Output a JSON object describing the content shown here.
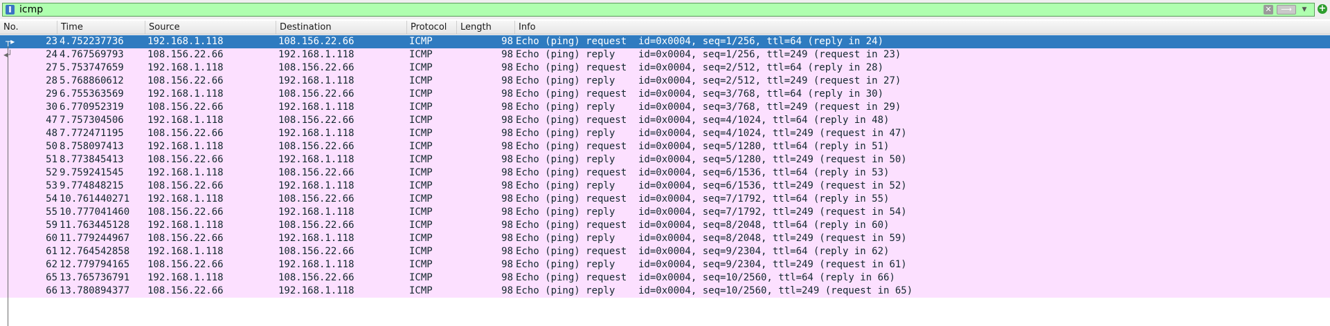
{
  "filter": {
    "value": "icmp",
    "clear_glyph": "✕",
    "apply_glyph": "⟶",
    "dropdown_glyph": "▼",
    "add_glyph": "+"
  },
  "columns": {
    "no": "No.",
    "time": "Time",
    "source": "Source",
    "destination": "Destination",
    "protocol": "Protocol",
    "length": "Length",
    "info": "Info"
  },
  "packets": [
    {
      "no": "23",
      "time": "4.752237736",
      "src": "192.168.1.118",
      "dst": "108.156.22.66",
      "proto": "ICMP",
      "len": "98",
      "info": "Echo (ping) request  id=0x0004, seq=1/256, ttl=64 (reply in 24)"
    },
    {
      "no": "24",
      "time": "4.767569793",
      "src": "108.156.22.66",
      "dst": "192.168.1.118",
      "proto": "ICMP",
      "len": "98",
      "info": "Echo (ping) reply    id=0x0004, seq=1/256, ttl=249 (request in 23)"
    },
    {
      "no": "27",
      "time": "5.753747659",
      "src": "192.168.1.118",
      "dst": "108.156.22.66",
      "proto": "ICMP",
      "len": "98",
      "info": "Echo (ping) request  id=0x0004, seq=2/512, ttl=64 (reply in 28)"
    },
    {
      "no": "28",
      "time": "5.768860612",
      "src": "108.156.22.66",
      "dst": "192.168.1.118",
      "proto": "ICMP",
      "len": "98",
      "info": "Echo (ping) reply    id=0x0004, seq=2/512, ttl=249 (request in 27)"
    },
    {
      "no": "29",
      "time": "6.755363569",
      "src": "192.168.1.118",
      "dst": "108.156.22.66",
      "proto": "ICMP",
      "len": "98",
      "info": "Echo (ping) request  id=0x0004, seq=3/768, ttl=64 (reply in 30)"
    },
    {
      "no": "30",
      "time": "6.770952319",
      "src": "108.156.22.66",
      "dst": "192.168.1.118",
      "proto": "ICMP",
      "len": "98",
      "info": "Echo (ping) reply    id=0x0004, seq=3/768, ttl=249 (request in 29)"
    },
    {
      "no": "47",
      "time": "7.757304506",
      "src": "192.168.1.118",
      "dst": "108.156.22.66",
      "proto": "ICMP",
      "len": "98",
      "info": "Echo (ping) request  id=0x0004, seq=4/1024, ttl=64 (reply in 48)"
    },
    {
      "no": "48",
      "time": "7.772471195",
      "src": "108.156.22.66",
      "dst": "192.168.1.118",
      "proto": "ICMP",
      "len": "98",
      "info": "Echo (ping) reply    id=0x0004, seq=4/1024, ttl=249 (request in 47)"
    },
    {
      "no": "50",
      "time": "8.758097413",
      "src": "192.168.1.118",
      "dst": "108.156.22.66",
      "proto": "ICMP",
      "len": "98",
      "info": "Echo (ping) request  id=0x0004, seq=5/1280, ttl=64 (reply in 51)"
    },
    {
      "no": "51",
      "time": "8.773845413",
      "src": "108.156.22.66",
      "dst": "192.168.1.118",
      "proto": "ICMP",
      "len": "98",
      "info": "Echo (ping) reply    id=0x0004, seq=5/1280, ttl=249 (request in 50)"
    },
    {
      "no": "52",
      "time": "9.759241545",
      "src": "192.168.1.118",
      "dst": "108.156.22.66",
      "proto": "ICMP",
      "len": "98",
      "info": "Echo (ping) request  id=0x0004, seq=6/1536, ttl=64 (reply in 53)"
    },
    {
      "no": "53",
      "time": "9.774848215",
      "src": "108.156.22.66",
      "dst": "192.168.1.118",
      "proto": "ICMP",
      "len": "98",
      "info": "Echo (ping) reply    id=0x0004, seq=6/1536, ttl=249 (request in 52)"
    },
    {
      "no": "54",
      "time": "10.761440271",
      "src": "192.168.1.118",
      "dst": "108.156.22.66",
      "proto": "ICMP",
      "len": "98",
      "info": "Echo (ping) request  id=0x0004, seq=7/1792, ttl=64 (reply in 55)"
    },
    {
      "no": "55",
      "time": "10.777041460",
      "src": "108.156.22.66",
      "dst": "192.168.1.118",
      "proto": "ICMP",
      "len": "98",
      "info": "Echo (ping) reply    id=0x0004, seq=7/1792, ttl=249 (request in 54)"
    },
    {
      "no": "59",
      "time": "11.763445128",
      "src": "192.168.1.118",
      "dst": "108.156.22.66",
      "proto": "ICMP",
      "len": "98",
      "info": "Echo (ping) request  id=0x0004, seq=8/2048, ttl=64 (reply in 60)"
    },
    {
      "no": "60",
      "time": "11.779244967",
      "src": "108.156.22.66",
      "dst": "192.168.1.118",
      "proto": "ICMP",
      "len": "98",
      "info": "Echo (ping) reply    id=0x0004, seq=8/2048, ttl=249 (request in 59)"
    },
    {
      "no": "61",
      "time": "12.764542858",
      "src": "192.168.1.118",
      "dst": "108.156.22.66",
      "proto": "ICMP",
      "len": "98",
      "info": "Echo (ping) request  id=0x0004, seq=9/2304, ttl=64 (reply in 62)"
    },
    {
      "no": "62",
      "time": "12.779794165",
      "src": "108.156.22.66",
      "dst": "192.168.1.118",
      "proto": "ICMP",
      "len": "98",
      "info": "Echo (ping) reply    id=0x0004, seq=9/2304, ttl=249 (request in 61)"
    },
    {
      "no": "65",
      "time": "13.765736791",
      "src": "192.168.1.118",
      "dst": "108.156.22.66",
      "proto": "ICMP",
      "len": "98",
      "info": "Echo (ping) request  id=0x0004, seq=10/2560, ttl=64 (reply in 66)"
    },
    {
      "no": "66",
      "time": "13.780894377",
      "src": "108.156.22.66",
      "dst": "192.168.1.118",
      "proto": "ICMP",
      "len": "98",
      "info": "Echo (ping) reply    id=0x0004, seq=10/2560, ttl=249 (request in 65)"
    }
  ],
  "selected_index": 0,
  "colors": {
    "row_icmp_bg": "#fce0ff",
    "row_selected_bg": "#2f7bc0",
    "filter_valid_bg": "#afffaf"
  },
  "icons": {
    "bookmark": "filter-bookmark-icon",
    "clear": "clear-filter-icon",
    "apply": "apply-filter-icon",
    "dropdown": "recent-filters-dropdown-icon",
    "add": "add-filter-button-icon",
    "related_request": "related-packet-request-icon",
    "related_reply": "related-packet-reply-icon"
  }
}
